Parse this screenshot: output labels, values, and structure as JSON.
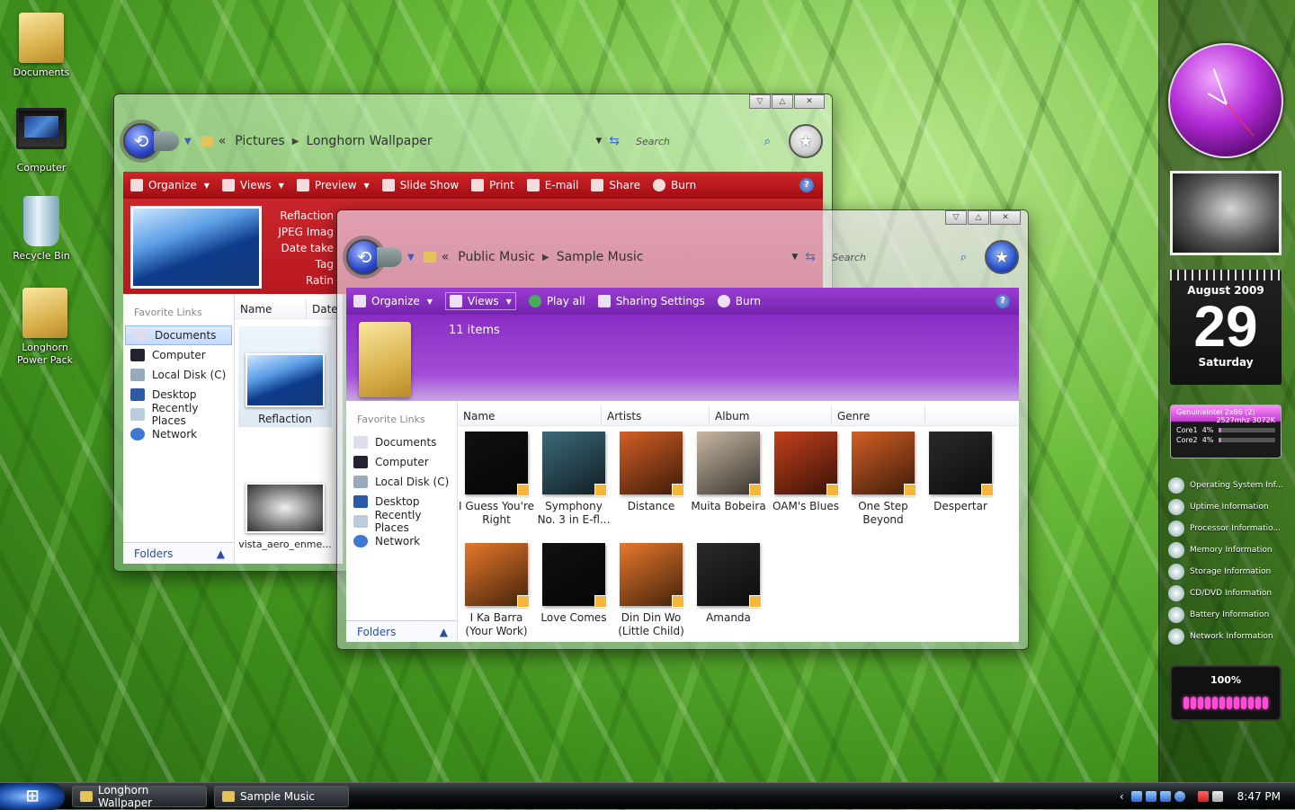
{
  "desktop": {
    "icons": [
      {
        "label": "Documents"
      },
      {
        "label": "Computer"
      },
      {
        "label": "Recycle Bin"
      },
      {
        "label": "Longhorn Power Pack"
      }
    ]
  },
  "window_pictures": {
    "breadcrumb": [
      "Pictures",
      "Longhorn Wallpaper"
    ],
    "breadcrumb_prefix": "«",
    "search_placeholder": "Search",
    "toolbar": [
      "Organize",
      "Views",
      "Preview",
      "Slide Show",
      "Print",
      "E-mail",
      "Share",
      "Burn"
    ],
    "preview": {
      "name": "Reflaction",
      "type": "JPEG Imag",
      "date": "Date take",
      "tags": "Tag",
      "rating": "Ratin"
    },
    "favorites_title": "Favorite Links",
    "nav": [
      "Documents",
      "Computer",
      "Local Disk (C)",
      "Desktop",
      "Recently Places",
      "Network"
    ],
    "folders_label": "Folders",
    "columns": [
      "Name",
      "Date"
    ],
    "files": [
      "Reflaction",
      "vista_aero_enme..."
    ],
    "accent": "#b10f16"
  },
  "window_music": {
    "breadcrumb": [
      "Public Music",
      "Sample Music"
    ],
    "breadcrumb_prefix": "«",
    "search_placeholder": "Search",
    "toolbar": [
      "Organize",
      "Views",
      "Play all",
      "Sharing Settings",
      "Burn"
    ],
    "item_count": "11 items",
    "favorites_title": "Favorite Links",
    "nav": [
      "Documents",
      "Computer",
      "Local Disk (C)",
      "Desktop",
      "Recently Places",
      "Network"
    ],
    "folders_label": "Folders",
    "columns": [
      "Name",
      "Artists",
      "Album",
      "Genre"
    ],
    "albums": [
      {
        "title": "I Guess You're Right",
        "color": "#111111"
      },
      {
        "title": "Symphony No. 3 in E-fl...",
        "color": "#3c6a7a"
      },
      {
        "title": "Distance",
        "color": "#d35f24"
      },
      {
        "title": "Muita Bobeira",
        "color": "#c8b8a2"
      },
      {
        "title": "OAM's Blues",
        "color": "#c4401c"
      },
      {
        "title": "One Step Beyond",
        "color": "#d35f24"
      },
      {
        "title": "Despertar",
        "color": "#2a2a2a"
      },
      {
        "title": "I Ka Barra (Your Work)",
        "color": "#e8782a"
      },
      {
        "title": "Love Comes",
        "color": "#111111"
      },
      {
        "title": "Din Din Wo (Little Child)",
        "color": "#e8782a"
      },
      {
        "title": "Amanda",
        "color": "#2a2a2a"
      }
    ],
    "accent": "#7c22b4"
  },
  "sidebar": {
    "calendar": {
      "month": "August 2009",
      "day": "29",
      "weekday": "Saturday"
    },
    "cpu": {
      "title": "GenuineIntel  2x86 (2)",
      "spec": "2527mhz 3072K",
      "cores": [
        {
          "label": "Core1",
          "value": "4%",
          "fraction": 0.04
        },
        {
          "label": "Core2",
          "value": "4%",
          "fraction": 0.04
        }
      ]
    },
    "sysinfo": [
      "Operating System Inf...",
      "Uptime Information",
      "Processor Informatio...",
      "Memory Information",
      "Storage Information",
      "CD/DVD Information",
      "Battery Information",
      "Network Information"
    ],
    "battery": {
      "label": "100%",
      "fraction": 1.0
    }
  },
  "taskbar": {
    "start_glyph": "⊞",
    "buttons": [
      "Longhorn Wallpaper",
      "Sample Music"
    ],
    "time": "8:47 PM",
    "tray_arrow": "‹"
  }
}
